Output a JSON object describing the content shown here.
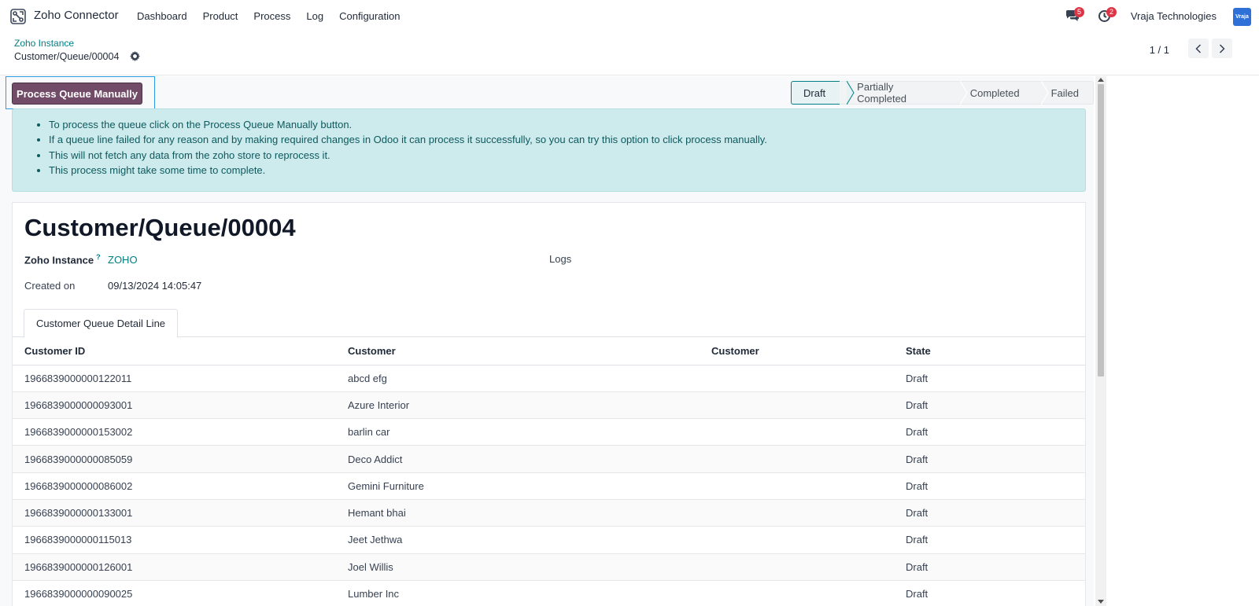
{
  "navbar": {
    "app_name": "Zoho Connector",
    "menu": [
      "Dashboard",
      "Product",
      "Process",
      "Log",
      "Configuration"
    ],
    "messages_count": "5",
    "activities_count": "2",
    "company": "Vraja Technologies",
    "avatar_text": "Vraja"
  },
  "breadcrumb": {
    "parent": "Zoho Instance",
    "current": "Customer/Queue/00004"
  },
  "pager": {
    "value": "1 / 1"
  },
  "actions": {
    "process_button": "Process Queue Manually"
  },
  "statusbar": {
    "stages": [
      "Draft",
      "Partially Completed",
      "Completed",
      "Failed"
    ],
    "active": "Draft"
  },
  "alert": {
    "items": [
      "To process the queue click on the Process Queue Manually button.",
      "If a queue line failed for any reason and by making required changes in Odoo it can process it successfully, so you can try this option to click process manually.",
      "This will not fetch any data from the zoho store to reprocess it.",
      "This process might take some time to complete."
    ]
  },
  "record": {
    "title": "Customer/Queue/00004",
    "zoho_instance_label": "Zoho Instance",
    "zoho_instance_help": "?",
    "zoho_instance_value": "ZOHO",
    "logs_label": "Logs",
    "created_on_label": "Created on",
    "created_on_value": "09/13/2024 14:05:47"
  },
  "tab": {
    "label": "Customer Queue Detail Line"
  },
  "table": {
    "headers": [
      "Customer ID",
      "Customer",
      "Customer",
      "State"
    ],
    "rows": [
      [
        "1966839000000122011",
        "abcd efg",
        "",
        "Draft"
      ],
      [
        "1966839000000093001",
        "Azure Interior",
        "",
        "Draft"
      ],
      [
        "1966839000000153002",
        "barlin car",
        "",
        "Draft"
      ],
      [
        "1966839000000085059",
        "Deco Addict",
        "",
        "Draft"
      ],
      [
        "1966839000000086002",
        "Gemini Furniture",
        "",
        "Draft"
      ],
      [
        "1966839000000133001",
        "Hemant bhai",
        "",
        "Draft"
      ],
      [
        "1966839000000115013",
        "Jeet Jethwa",
        "",
        "Draft"
      ],
      [
        "1966839000000126001",
        "Joel Willis",
        "",
        "Draft"
      ],
      [
        "1966839000000090025",
        "Lumber Inc",
        "",
        "Draft"
      ]
    ]
  },
  "colors": {
    "primary": "#714b67",
    "link": "#017e84",
    "alert_bg": "#cdeaec",
    "badge": "#dc3545"
  }
}
